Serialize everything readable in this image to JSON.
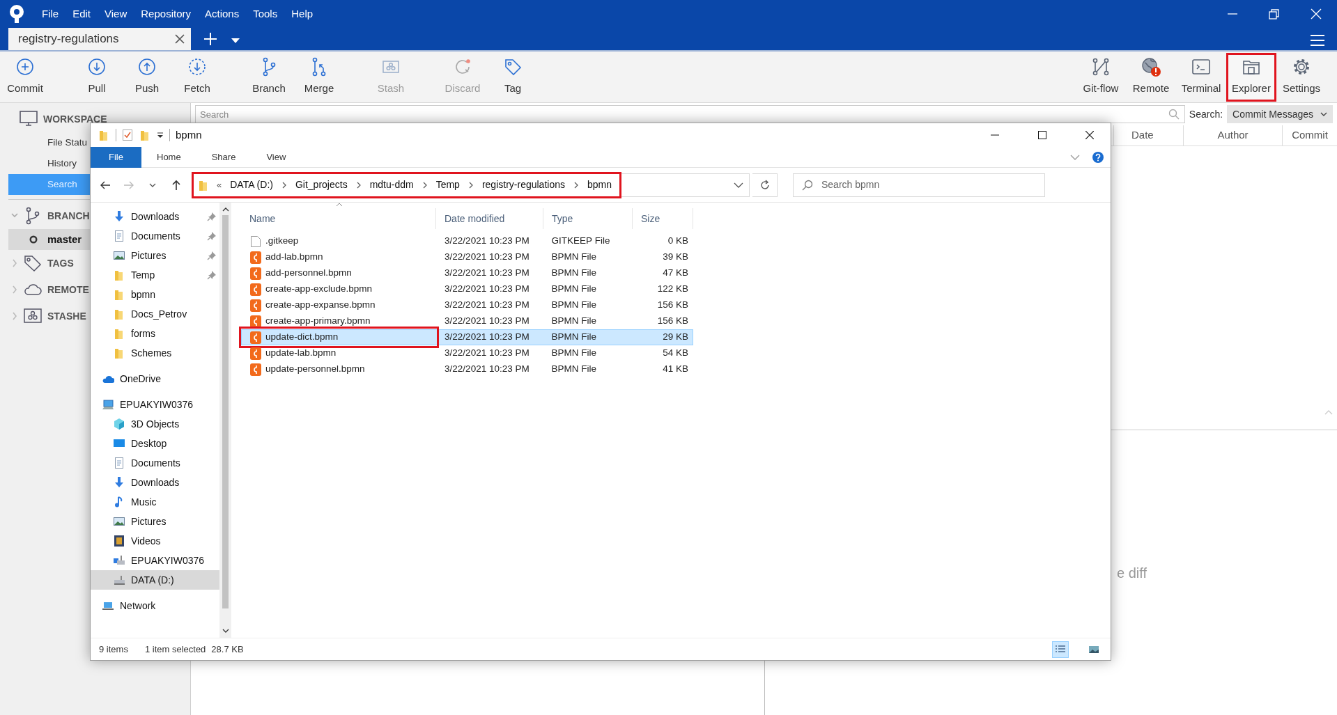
{
  "menu": [
    "File",
    "Edit",
    "View",
    "Repository",
    "Actions",
    "Tools",
    "Help"
  ],
  "tabs": [
    {
      "label": "registry-regulations",
      "selected": true
    }
  ],
  "toolbar": {
    "groups": [
      [
        {
          "label": "Commit",
          "kind": "commit",
          "disabled": false
        }
      ],
      [
        {
          "label": "Pull",
          "kind": "pull",
          "disabled": false
        },
        {
          "label": "Push",
          "kind": "push",
          "disabled": false
        },
        {
          "label": "Fetch",
          "kind": "fetch",
          "disabled": false
        }
      ],
      [
        {
          "label": "Branch",
          "kind": "branch",
          "disabled": false
        },
        {
          "label": "Merge",
          "kind": "merge",
          "disabled": false
        }
      ],
      [
        {
          "label": "Stash",
          "kind": "stash",
          "disabled": true
        }
      ],
      [
        {
          "label": "Discard",
          "kind": "discard",
          "disabled": true
        },
        {
          "label": "Tag",
          "kind": "tag",
          "disabled": false
        }
      ]
    ],
    "right": [
      {
        "label": "Git-flow",
        "kind": "gitflow",
        "highlighted": false
      },
      {
        "label": "Remote",
        "kind": "remote",
        "highlighted": false
      },
      {
        "label": "Terminal",
        "kind": "terminal",
        "highlighted": false
      },
      {
        "label": "Explorer",
        "kind": "explorer",
        "highlighted": true
      },
      {
        "label": "Settings",
        "kind": "settings",
        "highlighted": false
      }
    ]
  },
  "sidebar": [
    {
      "label": "WORKSPACE",
      "kind": "workspace",
      "items": [
        {
          "label": "File Statu",
          "selected": false
        },
        {
          "label": "History",
          "selected": false
        },
        {
          "label": "Search",
          "selected": true
        }
      ]
    },
    {
      "label": "BRANCH",
      "kind": "branches",
      "expanded": true,
      "items": [
        {
          "label": "master",
          "selected": true
        }
      ]
    },
    {
      "label": "TAGS",
      "kind": "tags",
      "expanded": false
    },
    {
      "label": "REMOTE",
      "kind": "remotes",
      "expanded": false
    },
    {
      "label": "STASHE",
      "kind": "stashes",
      "expanded": false
    }
  ],
  "search": {
    "placeholder": "Search",
    "mode_label": "Search:",
    "mode": "Commit Messages"
  },
  "columns": [
    "Date",
    "Author",
    "Commit"
  ],
  "diff_hint": "e diff",
  "explorer": {
    "title": "bpmn",
    "ribbon_tabs": [
      {
        "label": "File",
        "selected": true
      },
      {
        "label": "Home",
        "selected": false
      },
      {
        "label": "Share",
        "selected": false
      },
      {
        "label": "View",
        "selected": false
      }
    ],
    "path": {
      "highlighted": true,
      "prefix": "«",
      "crumbs": [
        "DATA (D:)",
        "Git_projects",
        "mdtu-ddm",
        "Temp",
        "registry-regulations",
        "bpmn"
      ]
    },
    "search": {
      "placeholder": "Search bpmn"
    },
    "quick_access": [
      {
        "label": "Downloads",
        "kind": "download",
        "pinned": true,
        "selected": false
      },
      {
        "label": "Documents",
        "kind": "doc",
        "pinned": true,
        "selected": false
      },
      {
        "label": "Pictures",
        "kind": "picture",
        "pinned": true,
        "selected": false
      },
      {
        "label": "Temp",
        "kind": "folder",
        "pinned": true,
        "selected": false
      },
      {
        "label": "bpmn",
        "kind": "folder",
        "pinned": false,
        "selected": false
      },
      {
        "label": "Docs_Petrov",
        "kind": "folder",
        "pinned": false,
        "selected": false
      },
      {
        "label": "forms",
        "kind": "folder",
        "pinned": false,
        "selected": false
      },
      {
        "label": "Schemes",
        "kind": "folder",
        "pinned": false,
        "selected": false
      }
    ],
    "tree": [
      {
        "label": "OneDrive",
        "kind": "cloud",
        "selected": false
      },
      {
        "label": "EPUAKYIW0376",
        "kind": "pc",
        "selected": false,
        "children": [
          {
            "label": "3D Objects",
            "kind": "cube",
            "selected": false
          },
          {
            "label": "Desktop",
            "kind": "desktop",
            "selected": false
          },
          {
            "label": "Documents",
            "kind": "doc",
            "selected": false
          },
          {
            "label": "Downloads",
            "kind": "download",
            "selected": false
          },
          {
            "label": "Music",
            "kind": "music",
            "selected": false
          },
          {
            "label": "Pictures",
            "kind": "picture",
            "selected": false
          },
          {
            "label": "Videos",
            "kind": "video",
            "selected": false
          },
          {
            "label": "EPUAKYIW0376",
            "kind": "netdrive",
            "selected": false
          },
          {
            "label": "DATA (D:)",
            "kind": "drive",
            "selected": true
          }
        ]
      },
      {
        "label": "Network",
        "kind": "network",
        "selected": false
      }
    ],
    "columns": [
      "Name",
      "Date modified",
      "Type",
      "Size"
    ],
    "files": [
      {
        "name": ".gitkeep",
        "kind": "text",
        "date": "3/22/2021 10:23 PM",
        "type": "GITKEEP File",
        "size": "0 KB",
        "selected": false,
        "highlighted": false
      },
      {
        "name": "add-lab.bpmn",
        "kind": "bpmn",
        "date": "3/22/2021 10:23 PM",
        "type": "BPMN File",
        "size": "39 KB",
        "selected": false,
        "highlighted": false
      },
      {
        "name": "add-personnel.bpmn",
        "kind": "bpmn",
        "date": "3/22/2021 10:23 PM",
        "type": "BPMN File",
        "size": "47 KB",
        "selected": false,
        "highlighted": false
      },
      {
        "name": "create-app-exclude.bpmn",
        "kind": "bpmn",
        "date": "3/22/2021 10:23 PM",
        "type": "BPMN File",
        "size": "122 KB",
        "selected": false,
        "highlighted": false
      },
      {
        "name": "create-app-expanse.bpmn",
        "kind": "bpmn",
        "date": "3/22/2021 10:23 PM",
        "type": "BPMN File",
        "size": "156 KB",
        "selected": false,
        "highlighted": false
      },
      {
        "name": "create-app-primary.bpmn",
        "kind": "bpmn",
        "date": "3/22/2021 10:23 PM",
        "type": "BPMN File",
        "size": "156 KB",
        "selected": false,
        "highlighted": false
      },
      {
        "name": "update-dict.bpmn",
        "kind": "bpmn",
        "date": "3/22/2021 10:23 PM",
        "type": "BPMN File",
        "size": "29 KB",
        "selected": true,
        "highlighted": true
      },
      {
        "name": "update-lab.bpmn",
        "kind": "bpmn",
        "date": "3/22/2021 10:23 PM",
        "type": "BPMN File",
        "size": "54 KB",
        "selected": false,
        "highlighted": false
      },
      {
        "name": "update-personnel.bpmn",
        "kind": "bpmn",
        "date": "3/22/2021 10:23 PM",
        "type": "BPMN File",
        "size": "41 KB",
        "selected": false,
        "highlighted": false
      }
    ],
    "status": {
      "count": "9 items",
      "selection": "1 item selected",
      "size": "28.7 KB"
    },
    "views": [
      {
        "kind": "details",
        "selected": true
      },
      {
        "kind": "large-icons",
        "selected": false
      }
    ]
  }
}
